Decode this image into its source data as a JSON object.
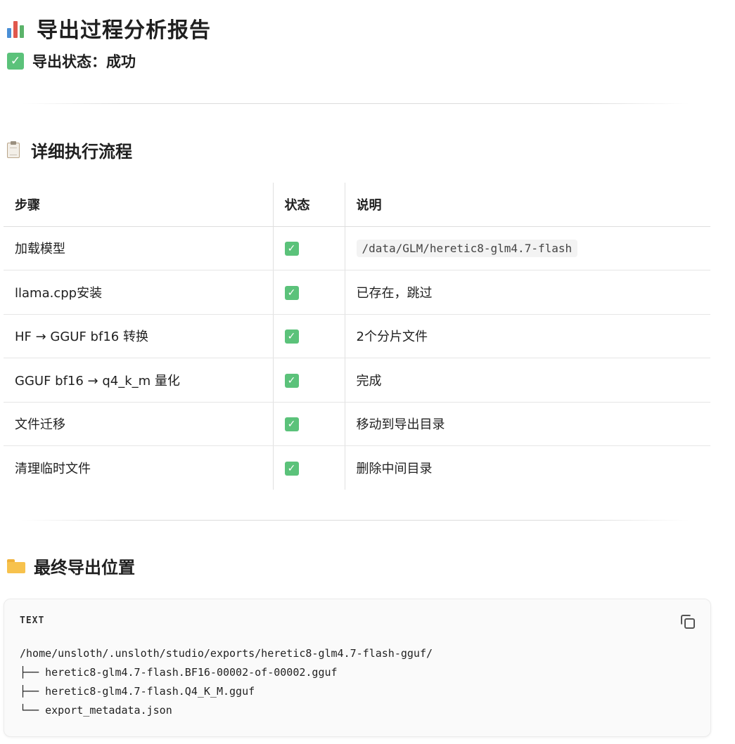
{
  "header": {
    "title": "导出过程分析报告",
    "status_check": "✓",
    "status_text": "导出状态：成功"
  },
  "process": {
    "title": "详细执行流程",
    "columns": [
      "步骤",
      "状态",
      "说明"
    ],
    "rows": [
      {
        "step": "加载模型",
        "status": "✓",
        "desc": "/data/GLM/heretic8-glm4.7-flash"
      },
      {
        "step": "llama.cpp安装",
        "status": "✓",
        "desc": "已存在，跳过"
      },
      {
        "step": "HF → GGUF bf16 转换",
        "status": "✓",
        "desc": "2个分片文件"
      },
      {
        "step": "GGUF bf16 → q4_k_m 量化",
        "status": "✓",
        "desc": "完成"
      },
      {
        "step": "文件迁移",
        "status": "✓",
        "desc": "移动到导出目录"
      },
      {
        "step": "清理临时文件",
        "status": "✓",
        "desc": "删除中间目录"
      }
    ]
  },
  "final": {
    "title": "最终导出位置",
    "code_lang": "TEXT",
    "code_lines": [
      "/home/unsloth/.unsloth/studio/exports/heretic8-glm4.7-flash-gguf/",
      "├── heretic8-glm4.7-flash.BF16-00002-of-00002.gguf",
      "├── heretic8-glm4.7-flash.Q4_K_M.gguf",
      "└── export_metadata.json"
    ]
  },
  "icons": {
    "title": "bar-chart-icon",
    "status": "check-mark-icon",
    "process": "clipboard-icon",
    "final": "folder-icon",
    "copy": "copy-icon"
  },
  "colors": {
    "check_green": "#5bc27a",
    "folder_yellow": "#f7c24d",
    "code_bg": "#fafafa",
    "chart_bars": [
      "#4a8fd6",
      "#e0584d",
      "#5bb36a"
    ]
  }
}
